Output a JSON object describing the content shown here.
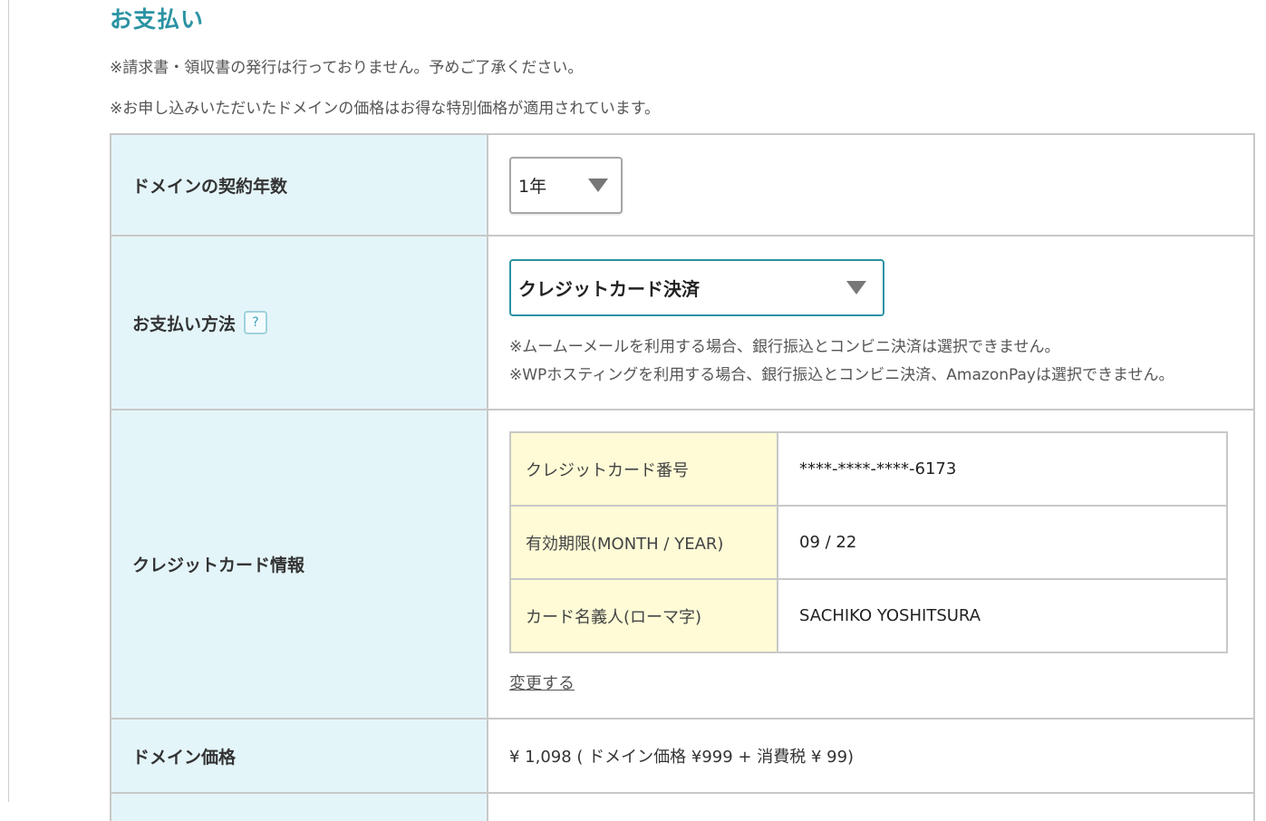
{
  "section": {
    "title": "お支払い",
    "notes": [
      "※請求書・領収書の発行は行っておりません。予めご了承ください。",
      "※お申し込みいただいたドメインの価格はお得な特別価格が適用されています。"
    ]
  },
  "form": {
    "contract_years": {
      "label": "ドメインの契約年数",
      "value": "1年"
    },
    "payment_method": {
      "label": "お支払い方法",
      "help": "?",
      "value": "クレジットカード決済",
      "notes": [
        "※ムームーメールを利用する場合、銀行振込とコンビニ決済は選択できません。",
        "※WPホスティングを利用する場合、銀行振込とコンビニ決済、AmazonPayは選択できません。"
      ]
    },
    "credit_card": {
      "label": "クレジットカード情報",
      "rows": [
        {
          "label": "クレジットカード番号",
          "value": "****-****-****-6173"
        },
        {
          "label": "有効期限(MONTH / YEAR)",
          "value": "09 / 22"
        },
        {
          "label": "カード名義人(ローマ字)",
          "value": "SACHIKO YOSHITSURA"
        }
      ],
      "change_link": "変更する"
    },
    "domain_price": {
      "label": "ドメイン価格",
      "value": "¥ 1,098 ( ドメイン価格 ¥999 + 消費税 ¥ 99)"
    }
  },
  "colors": {
    "accent": "#2a93a3",
    "header_cell_bg": "#e4f5f9",
    "card_label_bg": "#fefbd6",
    "border": "#c8c8c8"
  },
  "icons": {
    "select_arrow": "triangle-down-icon",
    "help": "question-icon"
  }
}
